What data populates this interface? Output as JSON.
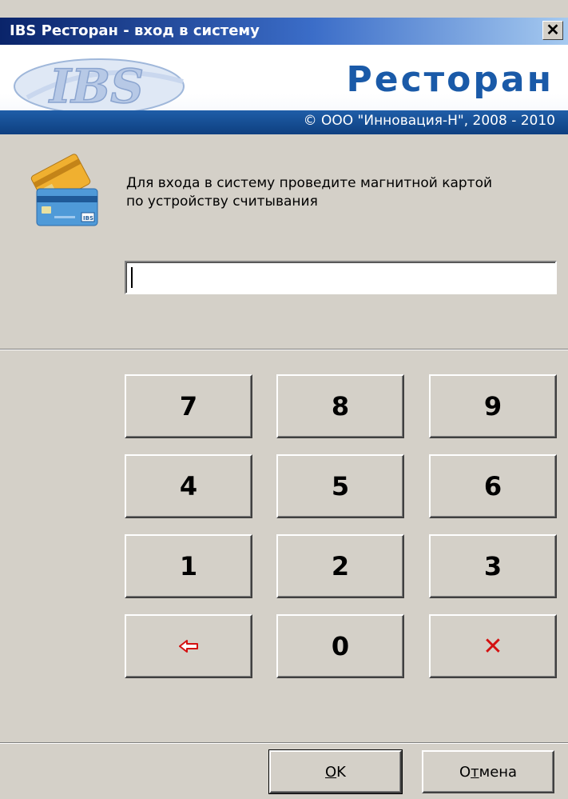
{
  "window": {
    "title": "IBS Ресторан - вход в систему",
    "close_label": "✕"
  },
  "banner": {
    "logo_text": "IBS",
    "app_name": "Ресторан",
    "copyright": "© ООО \"Инновация-Н\", 2008 - 2010"
  },
  "prompt": {
    "line1": "Для входа в систему проведите магнитной картой",
    "line2": "по устройству считывания"
  },
  "card_input": {
    "value": ""
  },
  "keypad": {
    "k7": "7",
    "k8": "8",
    "k9": "9",
    "k4": "4",
    "k5": "5",
    "k6": "6",
    "k1": "1",
    "k2": "2",
    "k3": "3",
    "k0": "0",
    "clear": "✕"
  },
  "buttons": {
    "ok_mnemonic": "O",
    "ok_rest": "K",
    "cancel_before": "О",
    "cancel_mnemonic": "т",
    "cancel_rest": "мена"
  },
  "colors": {
    "accent_red": "#d41010",
    "brand_blue": "#1a5aa8"
  }
}
